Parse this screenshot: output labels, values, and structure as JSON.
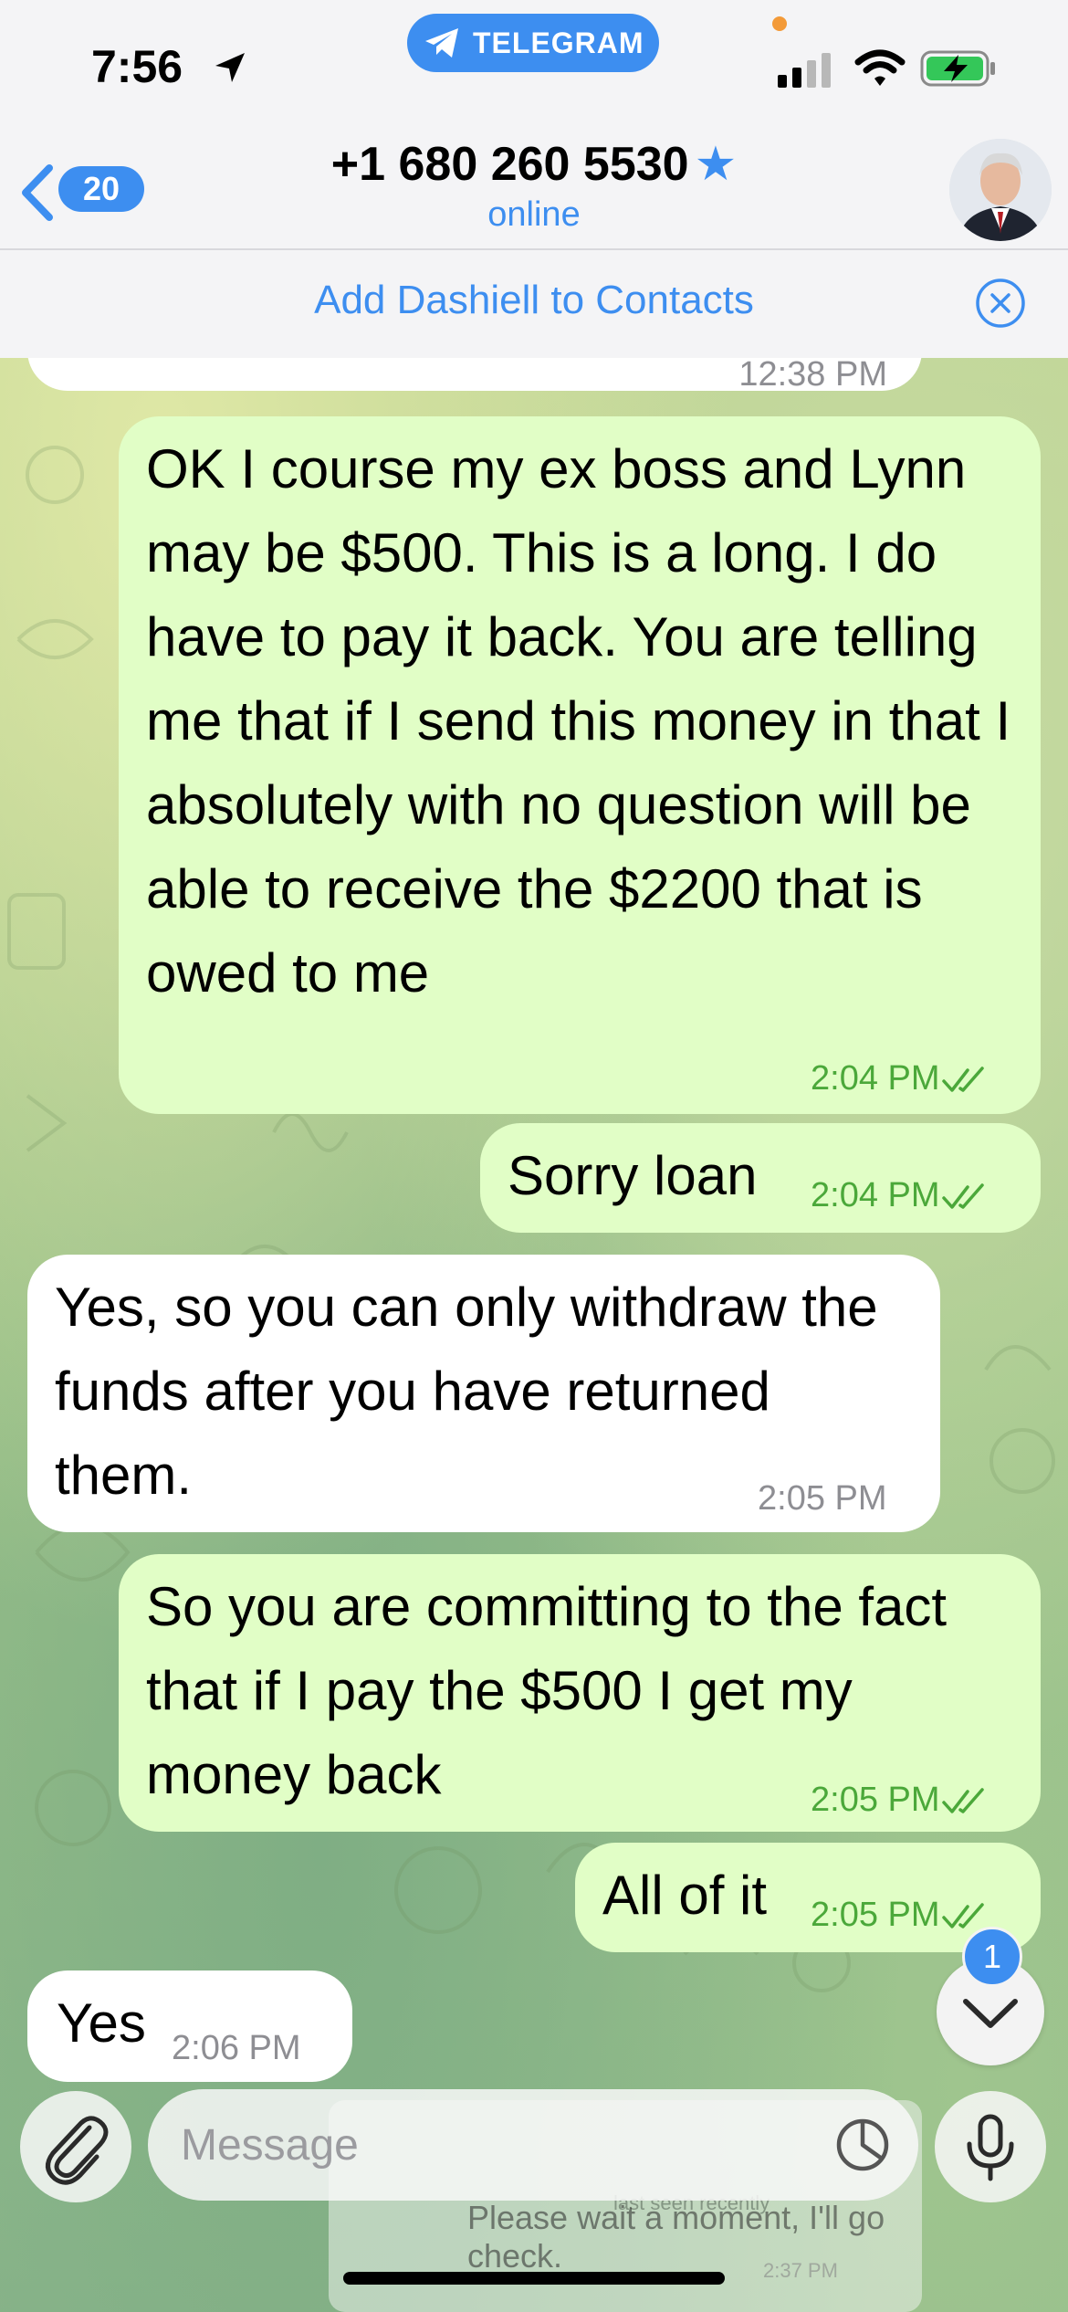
{
  "status_bar": {
    "time": "7:56",
    "app_pill": "TELEGRAM"
  },
  "header": {
    "back_count": "20",
    "title": "+1 680 260 5530",
    "status": "online"
  },
  "banner": {
    "add_contact": "Add Dashiell to Contacts"
  },
  "messages": [
    {
      "direction": "out",
      "text": "OK I course my ex boss and Lynn may be $500. This is a long. I do have to pay it back. You are telling me that if I send this money in that I absolutely with no question will be able to receive the $2200 that is owed to me",
      "time": "2:04 PM"
    },
    {
      "direction": "out",
      "text": "Sorry loan",
      "time": "2:04 PM"
    },
    {
      "direction": "in",
      "text": "Yes, so you can only withdraw the funds after you have returned them.",
      "time": "2:05 PM"
    },
    {
      "direction": "out",
      "text": "So you are committing to the fact that if I pay the $500 I get my money back",
      "time": "2:05 PM"
    },
    {
      "direction": "out",
      "text": "All of it",
      "time": "2:05 PM"
    },
    {
      "direction": "in",
      "text": "Yes",
      "time": "2:06 PM"
    }
  ],
  "previous_time_partial": "12:38 PM",
  "scroll_unread": "1",
  "composer": {
    "placeholder": "Message"
  },
  "background_preview": {
    "line1": "last seen recently",
    "line2": "Please wait a moment, I'll go",
    "line3": "check.",
    "time": "2:37 PM"
  },
  "colors": {
    "accent": "#3d8ef0",
    "outgoing_bubble": "#e1fec6",
    "incoming_bubble": "#ffffff",
    "outgoing_time": "#4ba83a"
  }
}
